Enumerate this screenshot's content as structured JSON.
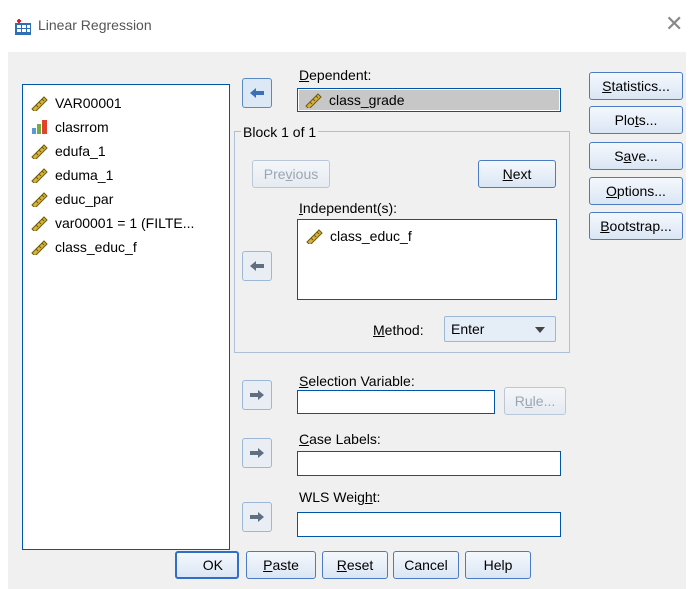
{
  "window": {
    "title": "Linear Regression"
  },
  "variables": [
    {
      "name": "VAR00001",
      "icon": "scale-ruler-icon"
    },
    {
      "name": "clasrrom",
      "icon": "nominal-bars-icon"
    },
    {
      "name": "edufa_1",
      "icon": "scale-ruler-icon"
    },
    {
      "name": "eduma_1",
      "icon": "scale-ruler-icon"
    },
    {
      "name": "educ_par",
      "icon": "scale-ruler-icon"
    },
    {
      "name": "var00001 = 1 (FILTE...",
      "icon": "scale-ruler-icon"
    },
    {
      "name": "class_educ_f",
      "icon": "scale-ruler-icon"
    }
  ],
  "dependent": {
    "label": "Dependent:",
    "label_key": "D",
    "label_rest": "ependent:",
    "value": "class_grade"
  },
  "block": {
    "title": "Block 1 of 1",
    "previous": {
      "pre": "Pre",
      "key": "v",
      "post": "ious"
    },
    "next": {
      "key": "N",
      "post": "ext"
    }
  },
  "independents": {
    "pre": "",
    "key": "I",
    "post": "ndependent(s):",
    "values": [
      "class_educ_f"
    ]
  },
  "method": {
    "key": "M",
    "post": "ethod:",
    "selected": "Enter"
  },
  "selection_variable": {
    "key": "S",
    "post": "election Variable:",
    "value": "",
    "rule": {
      "pre": "R",
      "key": "u",
      "post": "le..."
    }
  },
  "case_labels": {
    "key": "C",
    "post": "ase Labels:",
    "value": ""
  },
  "wls_weight": {
    "pre": "WLS Weig",
    "key": "h",
    "post": "t:",
    "value": ""
  },
  "side_buttons": [
    {
      "key": "S",
      "post": "tatistics..."
    },
    {
      "pre": "Plo",
      "key": "t",
      "post": "s..."
    },
    {
      "pre": "S",
      "key": "a",
      "post": "ve..."
    },
    {
      "key": "O",
      "post": "ptions..."
    },
    {
      "key": "B",
      "post": "ootstrap..."
    }
  ],
  "bottom_buttons": {
    "ok": "OK",
    "paste": {
      "key": "P",
      "post": "aste"
    },
    "reset": {
      "key": "R",
      "post": "eset"
    },
    "cancel": "Cancel",
    "help": "Help"
  },
  "colors": {
    "accent_border": "#0055a6",
    "dialog_bg": "#f0f0f0",
    "selected_bg": "#c7c7c7"
  }
}
